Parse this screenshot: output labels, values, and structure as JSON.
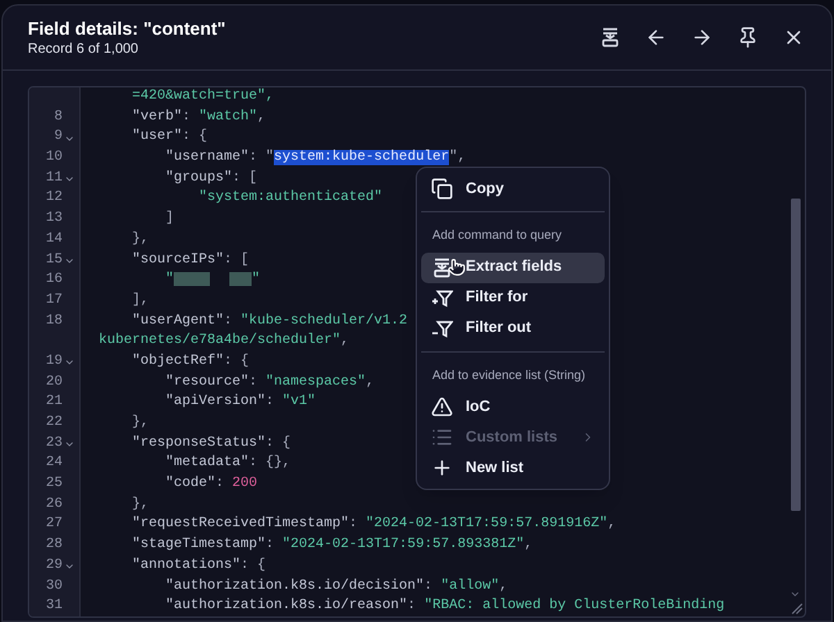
{
  "header": {
    "title": "Field details: \"content\"",
    "subtitle": "Record 6 of 1,000"
  },
  "editor": {
    "lines": [
      {
        "foldable": false,
        "segments": [
          {
            "kind": "str",
            "text": "    =420&watch=true\","
          }
        ]
      },
      {
        "number": "8",
        "foldable": false,
        "segments": [
          {
            "kind": "key",
            "text": "    \"verb\""
          },
          {
            "kind": "punct",
            "text": ": "
          },
          {
            "kind": "str",
            "text": "\"watch\""
          },
          {
            "kind": "punct",
            "text": ","
          }
        ]
      },
      {
        "number": "9",
        "foldable": true,
        "segments": [
          {
            "kind": "key",
            "text": "    \"user\""
          },
          {
            "kind": "punct",
            "text": ": {"
          }
        ]
      },
      {
        "number": "10",
        "foldable": false,
        "segments": [
          {
            "kind": "key",
            "text": "        \"username\""
          },
          {
            "kind": "punct",
            "text": ": \""
          },
          {
            "kind": "selected",
            "text": "system:kube-scheduler"
          },
          {
            "kind": "punct",
            "text": "\","
          }
        ]
      },
      {
        "number": "11",
        "foldable": true,
        "segments": [
          {
            "kind": "key",
            "text": "        \"groups\""
          },
          {
            "kind": "punct",
            "text": ": ["
          }
        ]
      },
      {
        "number": "12",
        "foldable": false,
        "segments": [
          {
            "kind": "str",
            "text": "            \"system:authenticated\""
          }
        ]
      },
      {
        "number": "13",
        "foldable": false,
        "segments": [
          {
            "kind": "punct",
            "text": "        ]"
          }
        ]
      },
      {
        "number": "14",
        "foldable": false,
        "segments": [
          {
            "kind": "punct",
            "text": "    },"
          }
        ]
      },
      {
        "number": "15",
        "foldable": true,
        "segments": [
          {
            "kind": "key",
            "text": "    \"sourceIPs\""
          },
          {
            "kind": "punct",
            "text": ": ["
          }
        ]
      },
      {
        "number": "16",
        "foldable": false,
        "segments": [
          {
            "kind": "str",
            "text": "        \""
          },
          {
            "kind": "redacted"
          },
          {
            "kind": "str",
            "text": "\""
          }
        ]
      },
      {
        "number": "17",
        "foldable": false,
        "segments": [
          {
            "kind": "punct",
            "text": "    ],"
          }
        ]
      },
      {
        "number": "18",
        "foldable": false,
        "segments": [
          {
            "kind": "key",
            "text": "    \"userAgent\""
          },
          {
            "kind": "punct",
            "text": ": "
          },
          {
            "kind": "str",
            "text": "\"kube-scheduler/v1.2"
          }
        ]
      },
      {
        "foldable": false,
        "segments": [
          {
            "kind": "str",
            "text": "kubernetes/e78a4be/scheduler\""
          },
          {
            "kind": "punct",
            "text": ","
          }
        ]
      },
      {
        "number": "19",
        "foldable": true,
        "segments": [
          {
            "kind": "key",
            "text": "    \"objectRef\""
          },
          {
            "kind": "punct",
            "text": ": {"
          }
        ]
      },
      {
        "number": "20",
        "foldable": false,
        "segments": [
          {
            "kind": "key",
            "text": "        \"resource\""
          },
          {
            "kind": "punct",
            "text": ": "
          },
          {
            "kind": "str",
            "text": "\"namespaces\""
          },
          {
            "kind": "punct",
            "text": ","
          }
        ]
      },
      {
        "number": "21",
        "foldable": false,
        "segments": [
          {
            "kind": "key",
            "text": "        \"apiVersion\""
          },
          {
            "kind": "punct",
            "text": ": "
          },
          {
            "kind": "str",
            "text": "\"v1\""
          }
        ]
      },
      {
        "number": "22",
        "foldable": false,
        "segments": [
          {
            "kind": "punct",
            "text": "    },"
          }
        ]
      },
      {
        "number": "23",
        "foldable": true,
        "segments": [
          {
            "kind": "key",
            "text": "    \"responseStatus\""
          },
          {
            "kind": "punct",
            "text": ": {"
          }
        ]
      },
      {
        "number": "24",
        "foldable": false,
        "segments": [
          {
            "kind": "key",
            "text": "        \"metadata\""
          },
          {
            "kind": "punct",
            "text": ": {},"
          }
        ]
      },
      {
        "number": "25",
        "foldable": false,
        "segments": [
          {
            "kind": "key",
            "text": "        \"code\""
          },
          {
            "kind": "punct",
            "text": ": "
          },
          {
            "kind": "num",
            "text": "200"
          }
        ]
      },
      {
        "number": "26",
        "foldable": false,
        "segments": [
          {
            "kind": "punct",
            "text": "    },"
          }
        ]
      },
      {
        "number": "27",
        "foldable": false,
        "segments": [
          {
            "kind": "key",
            "text": "    \"requestReceivedTimestamp\""
          },
          {
            "kind": "punct",
            "text": ": "
          },
          {
            "kind": "str",
            "text": "\"2024-02-13T17:59:57.891916Z\""
          },
          {
            "kind": "punct",
            "text": ","
          }
        ]
      },
      {
        "number": "28",
        "foldable": false,
        "segments": [
          {
            "kind": "key",
            "text": "    \"stageTimestamp\""
          },
          {
            "kind": "punct",
            "text": ": "
          },
          {
            "kind": "str",
            "text": "\"2024-02-13T17:59:57.893381Z\""
          },
          {
            "kind": "punct",
            "text": ","
          }
        ]
      },
      {
        "number": "29",
        "foldable": true,
        "segments": [
          {
            "kind": "key",
            "text": "    \"annotations\""
          },
          {
            "kind": "punct",
            "text": ": {"
          }
        ]
      },
      {
        "number": "30",
        "foldable": false,
        "segments": [
          {
            "kind": "key",
            "text": "        \"authorization.k8s.io/decision\""
          },
          {
            "kind": "punct",
            "text": ": "
          },
          {
            "kind": "str",
            "text": "\"allow\""
          },
          {
            "kind": "punct",
            "text": ","
          }
        ]
      },
      {
        "number": "31",
        "foldable": false,
        "segments": [
          {
            "kind": "key",
            "text": "        \"authorization.k8s.io/reason\""
          },
          {
            "kind": "punct",
            "text": ": "
          },
          {
            "kind": "str",
            "text": "\"RBAC: allowed by ClusterRoleBinding"
          }
        ]
      }
    ]
  },
  "menu": {
    "sections": [
      {
        "items": [
          {
            "label": "Copy",
            "selected": false,
            "disabled": false,
            "submenu": false
          }
        ]
      },
      {
        "heading": "Add command to query",
        "items": [
          {
            "label": "Extract fields",
            "selected": true,
            "disabled": false,
            "submenu": false
          },
          {
            "label": "Filter for",
            "selected": false,
            "disabled": false,
            "submenu": false
          },
          {
            "label": "Filter out",
            "selected": false,
            "disabled": false,
            "submenu": false
          }
        ]
      },
      {
        "heading": "Add to evidence list (String)",
        "items": [
          {
            "label": "IoC",
            "selected": false,
            "disabled": false,
            "submenu": false
          },
          {
            "label": "Custom lists",
            "selected": false,
            "disabled": true,
            "submenu": true
          },
          {
            "label": "New list",
            "selected": false,
            "disabled": false,
            "submenu": false
          }
        ]
      }
    ]
  }
}
